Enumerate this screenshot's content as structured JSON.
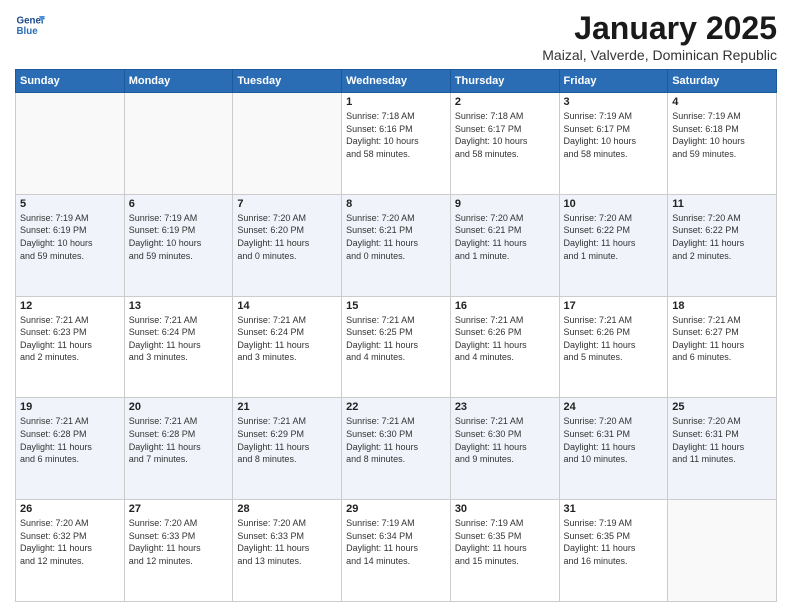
{
  "logo": {
    "text_general": "General",
    "text_blue": "Blue"
  },
  "header": {
    "month": "January 2025",
    "location": "Maizal, Valverde, Dominican Republic"
  },
  "days_of_week": [
    "Sunday",
    "Monday",
    "Tuesday",
    "Wednesday",
    "Thursday",
    "Friday",
    "Saturday"
  ],
  "weeks": [
    [
      {
        "day": "",
        "info": ""
      },
      {
        "day": "",
        "info": ""
      },
      {
        "day": "",
        "info": ""
      },
      {
        "day": "1",
        "info": "Sunrise: 7:18 AM\nSunset: 6:16 PM\nDaylight: 10 hours\nand 58 minutes."
      },
      {
        "day": "2",
        "info": "Sunrise: 7:18 AM\nSunset: 6:17 PM\nDaylight: 10 hours\nand 58 minutes."
      },
      {
        "day": "3",
        "info": "Sunrise: 7:19 AM\nSunset: 6:17 PM\nDaylight: 10 hours\nand 58 minutes."
      },
      {
        "day": "4",
        "info": "Sunrise: 7:19 AM\nSunset: 6:18 PM\nDaylight: 10 hours\nand 59 minutes."
      }
    ],
    [
      {
        "day": "5",
        "info": "Sunrise: 7:19 AM\nSunset: 6:19 PM\nDaylight: 10 hours\nand 59 minutes."
      },
      {
        "day": "6",
        "info": "Sunrise: 7:19 AM\nSunset: 6:19 PM\nDaylight: 10 hours\nand 59 minutes."
      },
      {
        "day": "7",
        "info": "Sunrise: 7:20 AM\nSunset: 6:20 PM\nDaylight: 11 hours\nand 0 minutes."
      },
      {
        "day": "8",
        "info": "Sunrise: 7:20 AM\nSunset: 6:21 PM\nDaylight: 11 hours\nand 0 minutes."
      },
      {
        "day": "9",
        "info": "Sunrise: 7:20 AM\nSunset: 6:21 PM\nDaylight: 11 hours\nand 1 minute."
      },
      {
        "day": "10",
        "info": "Sunrise: 7:20 AM\nSunset: 6:22 PM\nDaylight: 11 hours\nand 1 minute."
      },
      {
        "day": "11",
        "info": "Sunrise: 7:20 AM\nSunset: 6:22 PM\nDaylight: 11 hours\nand 2 minutes."
      }
    ],
    [
      {
        "day": "12",
        "info": "Sunrise: 7:21 AM\nSunset: 6:23 PM\nDaylight: 11 hours\nand 2 minutes."
      },
      {
        "day": "13",
        "info": "Sunrise: 7:21 AM\nSunset: 6:24 PM\nDaylight: 11 hours\nand 3 minutes."
      },
      {
        "day": "14",
        "info": "Sunrise: 7:21 AM\nSunset: 6:24 PM\nDaylight: 11 hours\nand 3 minutes."
      },
      {
        "day": "15",
        "info": "Sunrise: 7:21 AM\nSunset: 6:25 PM\nDaylight: 11 hours\nand 4 minutes."
      },
      {
        "day": "16",
        "info": "Sunrise: 7:21 AM\nSunset: 6:26 PM\nDaylight: 11 hours\nand 4 minutes."
      },
      {
        "day": "17",
        "info": "Sunrise: 7:21 AM\nSunset: 6:26 PM\nDaylight: 11 hours\nand 5 minutes."
      },
      {
        "day": "18",
        "info": "Sunrise: 7:21 AM\nSunset: 6:27 PM\nDaylight: 11 hours\nand 6 minutes."
      }
    ],
    [
      {
        "day": "19",
        "info": "Sunrise: 7:21 AM\nSunset: 6:28 PM\nDaylight: 11 hours\nand 6 minutes."
      },
      {
        "day": "20",
        "info": "Sunrise: 7:21 AM\nSunset: 6:28 PM\nDaylight: 11 hours\nand 7 minutes."
      },
      {
        "day": "21",
        "info": "Sunrise: 7:21 AM\nSunset: 6:29 PM\nDaylight: 11 hours\nand 8 minutes."
      },
      {
        "day": "22",
        "info": "Sunrise: 7:21 AM\nSunset: 6:30 PM\nDaylight: 11 hours\nand 8 minutes."
      },
      {
        "day": "23",
        "info": "Sunrise: 7:21 AM\nSunset: 6:30 PM\nDaylight: 11 hours\nand 9 minutes."
      },
      {
        "day": "24",
        "info": "Sunrise: 7:20 AM\nSunset: 6:31 PM\nDaylight: 11 hours\nand 10 minutes."
      },
      {
        "day": "25",
        "info": "Sunrise: 7:20 AM\nSunset: 6:31 PM\nDaylight: 11 hours\nand 11 minutes."
      }
    ],
    [
      {
        "day": "26",
        "info": "Sunrise: 7:20 AM\nSunset: 6:32 PM\nDaylight: 11 hours\nand 12 minutes."
      },
      {
        "day": "27",
        "info": "Sunrise: 7:20 AM\nSunset: 6:33 PM\nDaylight: 11 hours\nand 12 minutes."
      },
      {
        "day": "28",
        "info": "Sunrise: 7:20 AM\nSunset: 6:33 PM\nDaylight: 11 hours\nand 13 minutes."
      },
      {
        "day": "29",
        "info": "Sunrise: 7:19 AM\nSunset: 6:34 PM\nDaylight: 11 hours\nand 14 minutes."
      },
      {
        "day": "30",
        "info": "Sunrise: 7:19 AM\nSunset: 6:35 PM\nDaylight: 11 hours\nand 15 minutes."
      },
      {
        "day": "31",
        "info": "Sunrise: 7:19 AM\nSunset: 6:35 PM\nDaylight: 11 hours\nand 16 minutes."
      },
      {
        "day": "",
        "info": ""
      }
    ]
  ]
}
